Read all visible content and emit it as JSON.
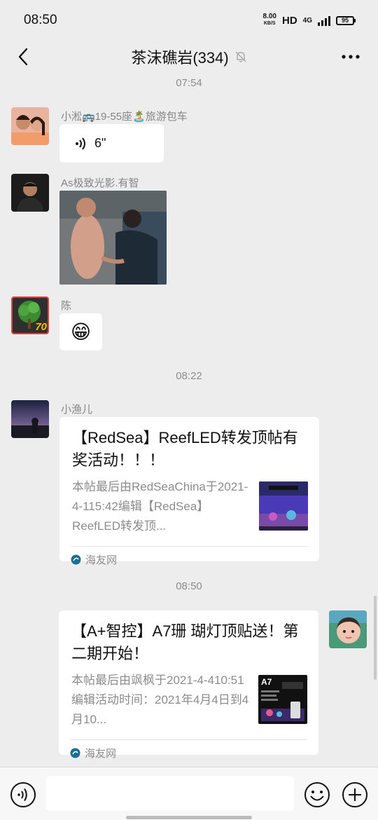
{
  "status_bar": {
    "time": "08:50",
    "speed_value": "8.00",
    "speed_unit": "KB/S",
    "hd": "HD",
    "network": "4G",
    "battery": "95"
  },
  "header": {
    "title": "茶沫礁岩(334)"
  },
  "timestamps": [
    "07:54",
    "08:22",
    "08:50"
  ],
  "messages": [
    {
      "sender": "小淞🚌19-55座🏝️旅游包车",
      "type": "voice",
      "duration": "6\""
    },
    {
      "sender": "As极致光影.有智",
      "type": "image"
    },
    {
      "sender": "陈",
      "type": "emoji",
      "emoji": "😁",
      "avatar_badge": "70"
    },
    {
      "sender": "小渔儿",
      "type": "link",
      "title": "【RedSea】ReefLED转发顶帖有奖活动！！！",
      "desc": "本帖最后由RedSeaChina于2021-4-115:42编辑【RedSea】ReefLED转发顶...",
      "source": "海友网"
    },
    {
      "sender": "",
      "type": "link",
      "self": true,
      "title": "【A+智控】A7珊 瑚灯顶贴送！第二期开始！",
      "desc": "本帖最后由飒枫于2021-4-410:51编辑活动时间：2021年4月4日到4月10...",
      "thumb_label": "A7",
      "source": "海友网"
    }
  ],
  "colors": {
    "background": "#ededed",
    "bubble": "#ffffff",
    "meta_text": "#8c8c8c"
  }
}
